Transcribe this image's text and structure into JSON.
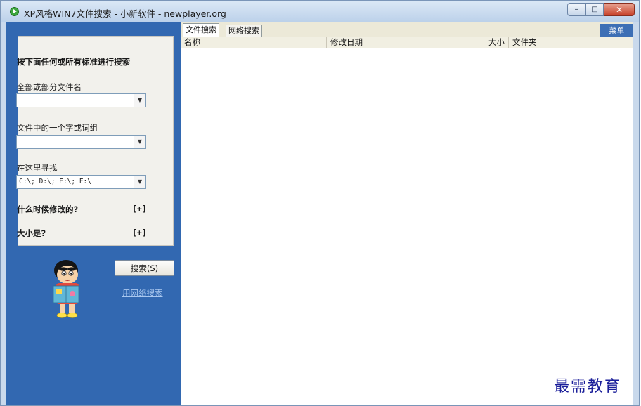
{
  "window": {
    "title": "XP风格WIN7文件搜索 - 小新软件 - newplayer.org",
    "buttons": {
      "minimize": "–",
      "maximize": "□",
      "close": "✕"
    }
  },
  "search_panel": {
    "heading": "按下面任何或所有标准进行搜索",
    "filename_label": "全部或部分文件名",
    "filename_value": "",
    "word_label": "文件中的一个字或词组",
    "word_value": "",
    "location_label": "在这里寻找",
    "location_value": "C:\\; D:\\; E:\\; F:\\",
    "modified_label": "什么时候修改的?",
    "modified_toggle": "[+]",
    "size_label": "大小是?",
    "size_toggle": "[+]",
    "search_button": "搜索(S)",
    "network_link": "用网络搜索"
  },
  "results": {
    "tabs": [
      "文件搜索",
      "网络搜索"
    ],
    "active_tab": 0,
    "menu_label": "菜单",
    "columns": [
      "名称",
      "修改日期",
      "大小",
      "文件夹"
    ]
  },
  "watermark": "最需教育",
  "colors": {
    "sidebar": "#3268b1",
    "panel": "#f2f1ec",
    "link": "#a9c7ef",
    "menu": "#3d6fb5"
  }
}
